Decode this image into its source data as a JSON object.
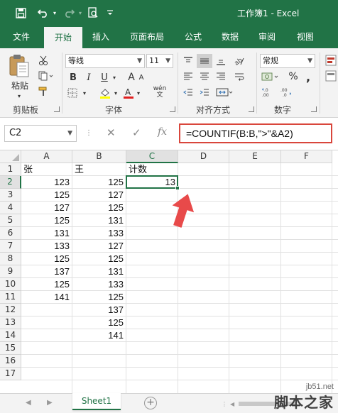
{
  "window": {
    "title": "工作簿1 - Excel"
  },
  "colors": {
    "brand_green": "#217346",
    "highlight_red": "#d9463c",
    "arrow_red": "#e84a4a"
  },
  "quick_access": [
    {
      "name": "save-icon",
      "glyph": "🖫"
    },
    {
      "name": "undo-icon",
      "glyph": "↶"
    },
    {
      "name": "redo-icon",
      "glyph": "↷"
    },
    {
      "name": "print-preview-icon",
      "glyph": "🔍"
    },
    {
      "name": "customize-qat-icon",
      "glyph": "▾"
    }
  ],
  "tabs": [
    "文件",
    "开始",
    "插入",
    "页面布局",
    "公式",
    "数据",
    "审阅",
    "视图"
  ],
  "active_tab": "开始",
  "ribbon": {
    "clipboard": {
      "paste_label": "粘贴",
      "group_label": "剪贴板"
    },
    "font": {
      "font_name": "等线",
      "font_size": "11",
      "bold": "B",
      "italic": "I",
      "underline": "U",
      "phonetic": "wén",
      "group_label": "字体"
    },
    "alignment": {
      "group_label": "对齐方式"
    },
    "number": {
      "format": "常规",
      "percent": "%",
      "comma": ",",
      "group_label": "数字"
    }
  },
  "formula_bar": {
    "name_box": "C2",
    "cancel": "✕",
    "enter": "✓",
    "fx": "fx",
    "formula": "=COUNTIF(B:B,\">\"&A2)"
  },
  "grid": {
    "columns": [
      "A",
      "B",
      "C",
      "D",
      "E",
      "F"
    ],
    "rows": [
      "1",
      "2",
      "3",
      "4",
      "5",
      "6",
      "7",
      "8",
      "9",
      "10",
      "11",
      "12",
      "13",
      "14",
      "15",
      "16",
      "17"
    ],
    "selected_cell": "C2",
    "cells": {
      "A1": "张",
      "B1": "王",
      "C1": "计数",
      "A2": "123",
      "B2": "125",
      "C2": "13",
      "A3": "125",
      "B3": "127",
      "A4": "127",
      "B4": "125",
      "A5": "125",
      "B5": "131",
      "A6": "131",
      "B6": "133",
      "A7": "133",
      "B7": "127",
      "A8": "125",
      "B8": "125",
      "A9": "137",
      "B9": "131",
      "A10": "125",
      "B10": "133",
      "A11": "141",
      "B11": "125",
      "B12": "137",
      "B13": "125",
      "B14": "141"
    }
  },
  "sheet_tabs": {
    "tabs": [
      "Sheet1"
    ],
    "add_label": "+"
  },
  "watermark": {
    "line1": "jb51.net",
    "line2": "脚本之家"
  }
}
